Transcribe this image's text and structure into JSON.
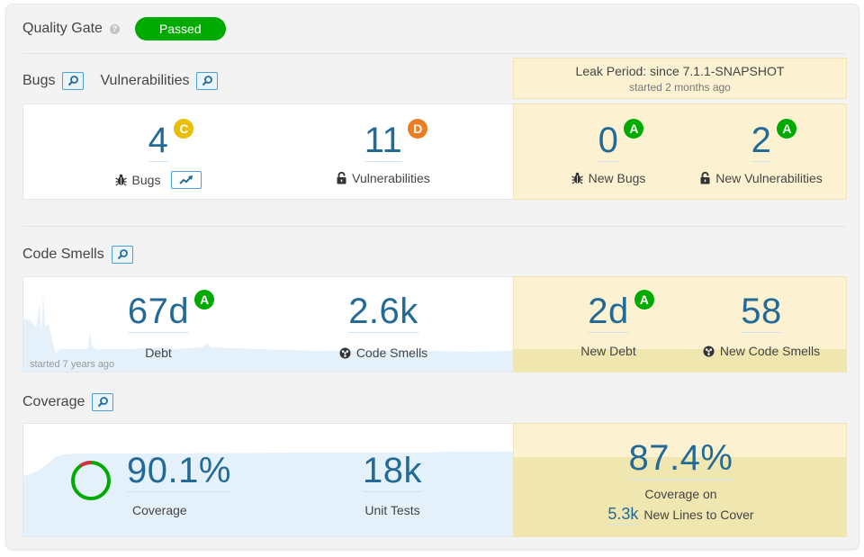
{
  "quality_gate": {
    "title": "Quality Gate",
    "help_icon": "question-circle-icon",
    "status": "Passed",
    "status_color": "#00aa00"
  },
  "bugs_section": {
    "title_bugs": "Bugs",
    "title_vulnerabilities": "Vulnerabilities",
    "drilldown_icon": "search-icon",
    "measures": [
      {
        "value": "4",
        "rating": "C",
        "rating_color": "#eabe06",
        "label": "Bugs",
        "icon": "bug-icon",
        "has_trend_button": true
      },
      {
        "value": "11",
        "rating": "D",
        "rating_color": "#ed7d20",
        "label": "Vulnerabilities",
        "icon": "lock-open-icon"
      }
    ]
  },
  "leak_period": {
    "title": "Leak Period: since 7.1.1-SNAPSHOT",
    "subtitle": "started 2 months ago",
    "bugs_measures": [
      {
        "value": "0",
        "rating": "A",
        "rating_color": "#00aa00",
        "label": "New Bugs",
        "icon": "bug-icon"
      },
      {
        "value": "2",
        "rating": "A",
        "rating_color": "#00aa00",
        "label": "New Vulnerabilities",
        "icon": "lock-open-icon"
      }
    ]
  },
  "code_smells_section": {
    "title": "Code Smells",
    "measures": [
      {
        "value": "67d",
        "rating": "A",
        "rating_color": "#00aa00",
        "label": "Debt"
      },
      {
        "value": "2.6k",
        "label": "Code Smells",
        "icon": "radiation-icon"
      }
    ],
    "history_note": "started 7 years ago",
    "leak_measures": [
      {
        "value": "2d",
        "rating": "A",
        "rating_color": "#00aa00",
        "label": "New Debt"
      },
      {
        "value": "58",
        "label": "New Code Smells",
        "icon": "radiation-icon"
      }
    ]
  },
  "coverage_section": {
    "title": "Coverage",
    "measures": [
      {
        "value": "90.1%",
        "label": "Coverage",
        "ring_percent": 90.1
      },
      {
        "value": "18k",
        "label": "Unit Tests"
      }
    ],
    "leak": {
      "value": "87.4%",
      "label_line1": "Coverage on",
      "lines_value": "5.3k",
      "lines_label": "New Lines to Cover"
    }
  },
  "colors": {
    "value_blue": "#236a97",
    "leak_bg": "#fcf2d2",
    "history_fill": "#e4f0fa",
    "leak_history_fill": "#f0e6b0",
    "ring_covered": "#00aa00",
    "ring_uncovered": "#d4333f"
  }
}
